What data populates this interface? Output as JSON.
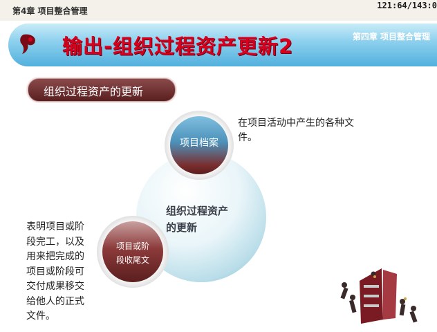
{
  "header": {
    "chapter_tag": "第4章 项目整合管理",
    "page_counter": "121:64/143:0"
  },
  "banner": {
    "title": "输出-组织过程资产更新2",
    "chapter_right": "第四章 项目整合管理",
    "icon": "bullet-mark-icon"
  },
  "section": {
    "label": "组织过程资产的更新"
  },
  "diagram": {
    "center_label": "组织过程资产的更新",
    "center_line1": "组织过程资产",
    "center_line2": "的更新",
    "node_top": "项目档案",
    "node_bottom_line1": "项目或阶",
    "node_bottom_line2": "段收尾文",
    "desc_top_line1": "在项目活动中产生的各种文",
    "desc_top_line2": "件。",
    "desc_left_lines": [
      "表明项目或阶",
      "段完工，以及",
      "用来把完成的",
      "项目或阶段可",
      "交付成果移交",
      "给他人的正式",
      "文件。"
    ]
  },
  "colors": {
    "banner_title": "#d8001c",
    "banner_bg": "#52b0dd",
    "pill_bg": "#5a1f20"
  }
}
